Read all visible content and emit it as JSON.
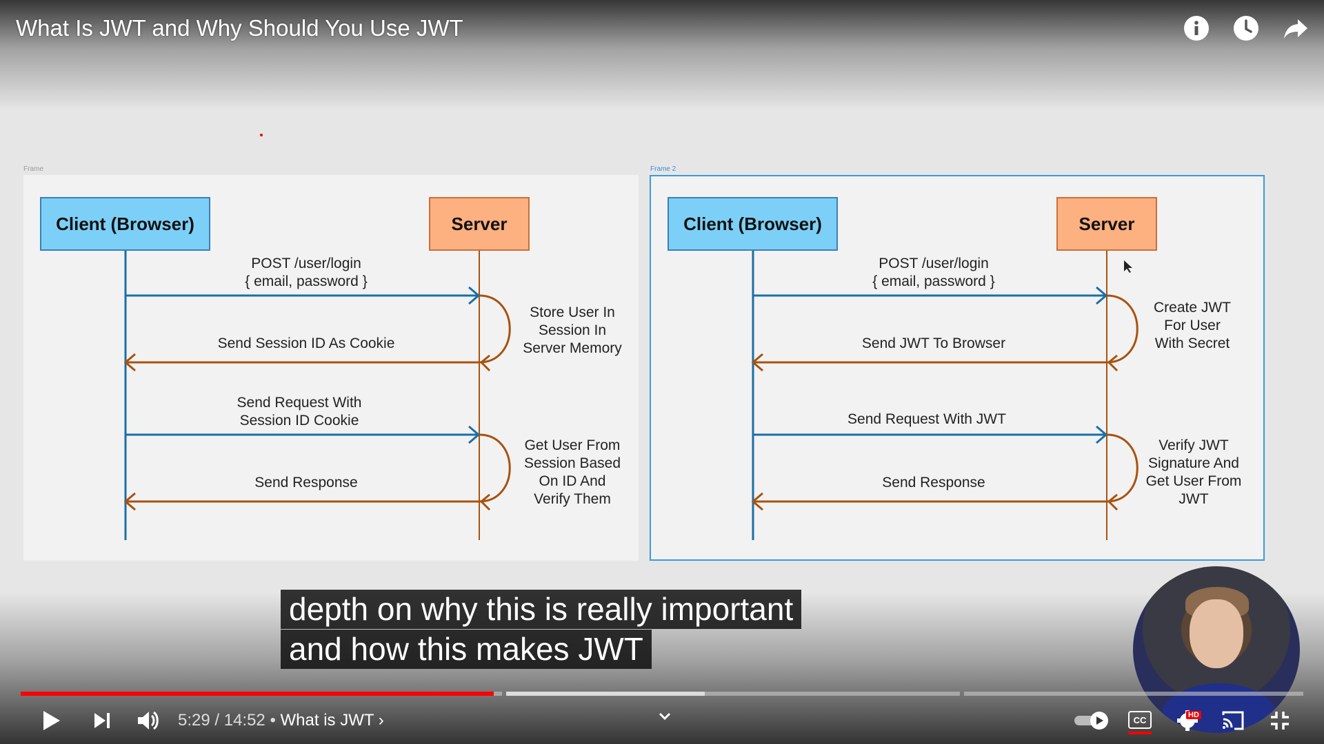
{
  "video": {
    "title": "What Is JWT and Why Should You Use JWT"
  },
  "top_icons": [
    "info-icon",
    "watch-later-icon",
    "share-icon"
  ],
  "frames": [
    {
      "label": "Frame",
      "client": "Client (Browser)",
      "server": "Server",
      "arrows": [
        {
          "text": "POST  /user/login\n{ email, password }",
          "direction": "to-server"
        },
        {
          "text": "Send Session ID As Cookie",
          "direction": "to-client"
        },
        {
          "text": "Send Request With\nSession ID Cookie",
          "direction": "to-server"
        },
        {
          "text": "Send Response",
          "direction": "to-client"
        }
      ],
      "notes": [
        "Store User In\nSession In\nServer Memory",
        "Get User From\nSession Based\nOn ID And\nVerify Them"
      ]
    },
    {
      "label": "Frame 2",
      "client": "Client (Browser)",
      "server": "Server",
      "arrows": [
        {
          "text": "POST  /user/login\n{ email, password }",
          "direction": "to-server"
        },
        {
          "text": "Send JWT To Browser",
          "direction": "to-client"
        },
        {
          "text": "Send Request With JWT",
          "direction": "to-server"
        },
        {
          "text": "Send Response",
          "direction": "to-client"
        }
      ],
      "notes": [
        "Create JWT\nFor User\nWith Secret",
        "Verify JWT\nSignature And\nGet User From\nJWT"
      ]
    }
  ],
  "subtitles": {
    "line1": "depth on why this is really important",
    "line2": "and how this makes JWT"
  },
  "player": {
    "current_time": "5:29",
    "duration": "14:52",
    "time_display": "5:29 / 14:52",
    "separator": "•",
    "chapter": "What is JWT",
    "chapter_arrow": "›",
    "progress_fraction": 0.369,
    "colors": {
      "played": "#ff0000",
      "client": "#7cd0f7",
      "server": "#fdb080",
      "request_arrow": "#1a6fa6",
      "response_arrow": "#a8520f"
    }
  },
  "controls_left": [
    "play-icon",
    "next-icon",
    "volume-icon"
  ],
  "controls_right": [
    "autoplay-toggle",
    "captions-icon",
    "settings-icon",
    "cast-icon",
    "exit-fullscreen-icon"
  ],
  "settings_badge": "HD",
  "captions_label": "CC"
}
